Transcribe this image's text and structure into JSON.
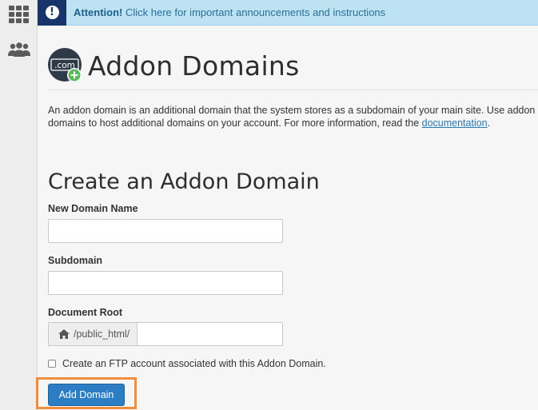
{
  "banner": {
    "strong": "Attention!",
    "text": " Click here for important announcements and instructions"
  },
  "page": {
    "title": "Addon Domains",
    "icon_text": ".com",
    "description": "An addon domain is an additional domain that the system stores as a subdomain of your main site. Use addon domains to host additional domains on your account. For more information, read the ",
    "description_link": "documentation",
    "description_end": "."
  },
  "form": {
    "section_title": "Create an Addon Domain",
    "new_domain_label": "New Domain Name",
    "new_domain_value": "",
    "subdomain_label": "Subdomain",
    "subdomain_value": "",
    "docroot_label": "Document Root",
    "docroot_prefix": "/public_html/",
    "docroot_value": "",
    "ftp_checkbox_label": "Create an FTP account associated with this Addon Domain.",
    "ftp_checked": false,
    "submit_label": "Add Domain"
  },
  "colors": {
    "primary_button": "#2b7ec3",
    "highlight": "#ef8d3b",
    "banner_bg": "#bde2f2",
    "banner_icon_bg": "#17356a"
  }
}
